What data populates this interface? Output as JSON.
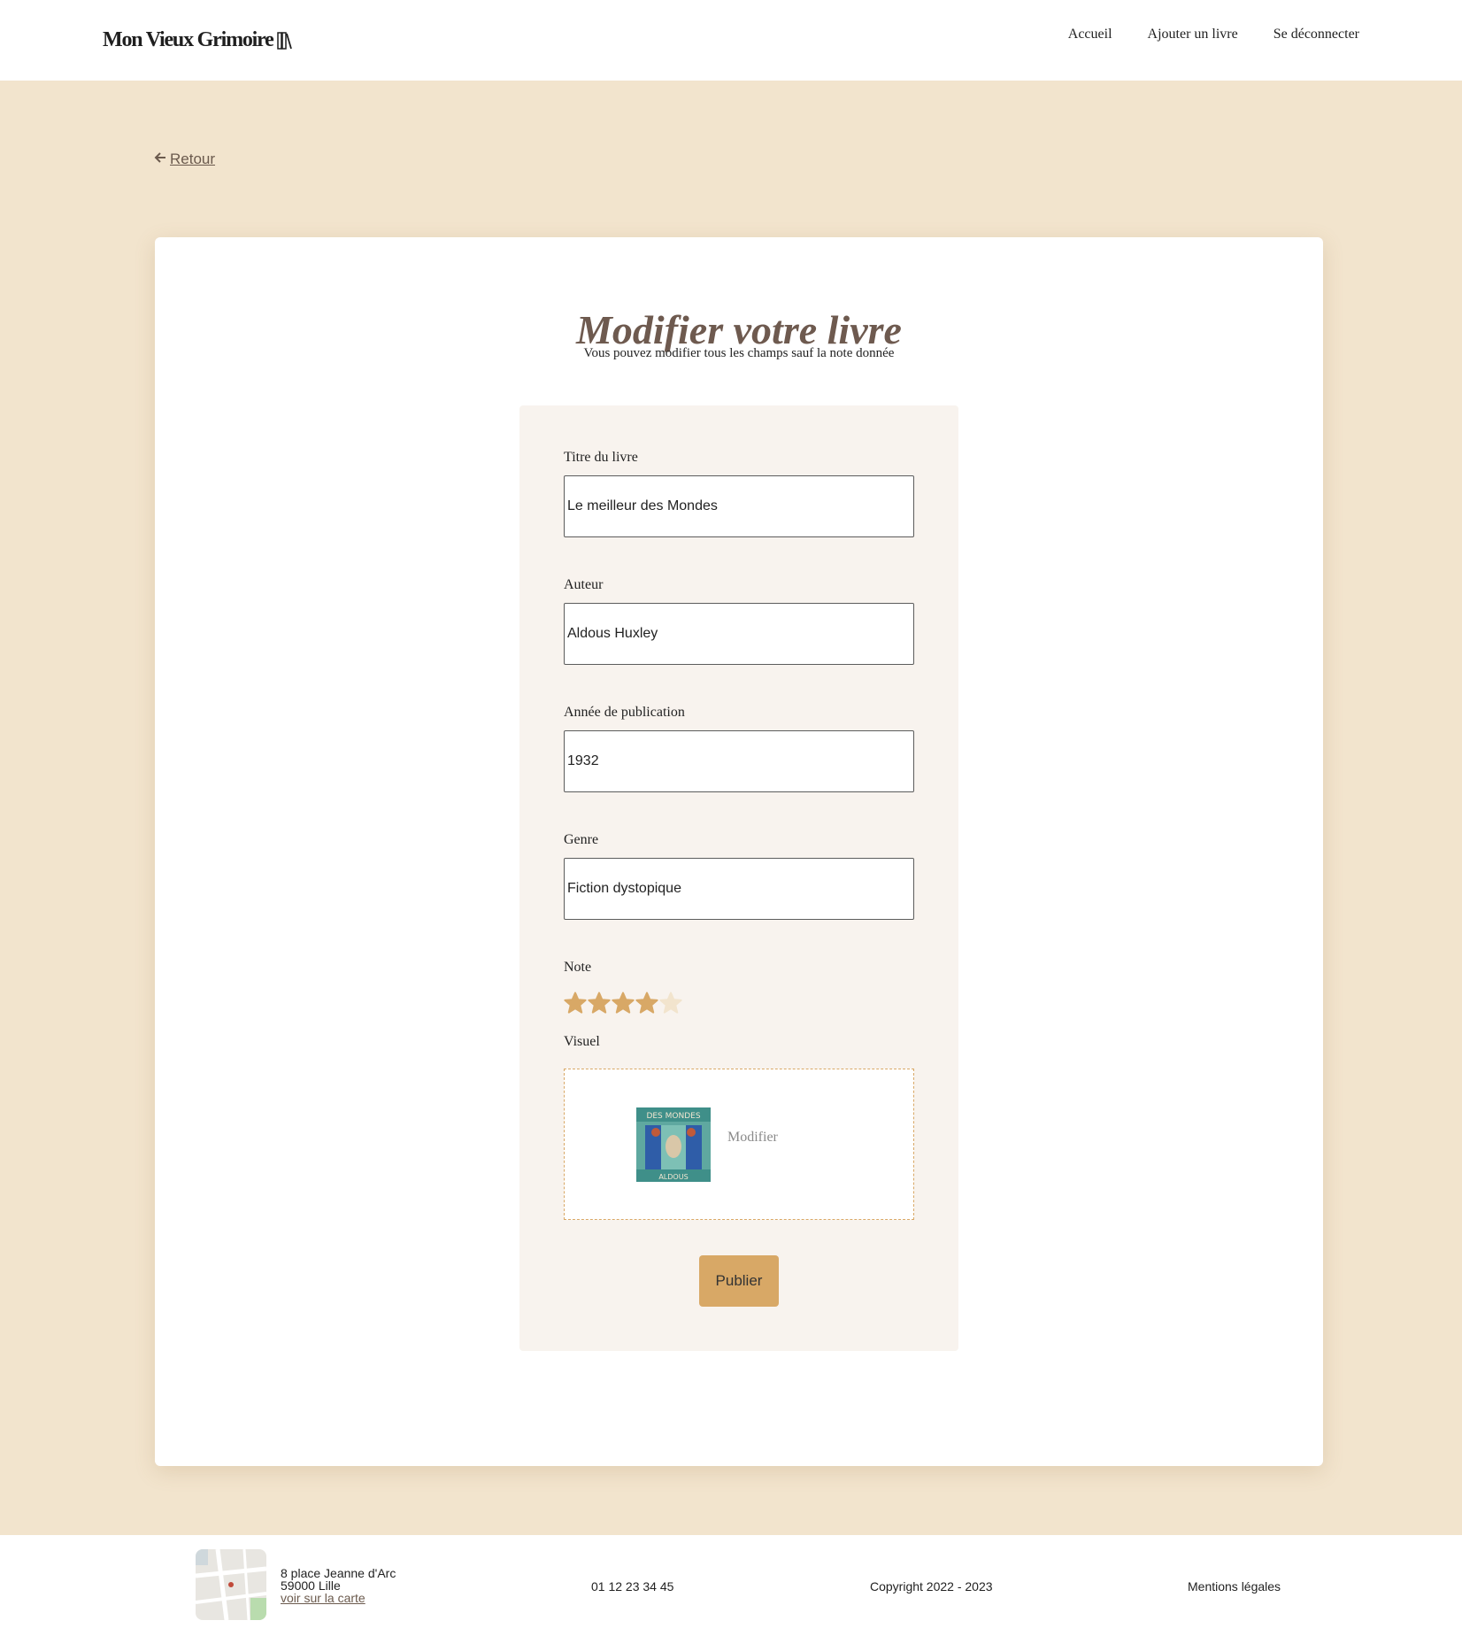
{
  "header": {
    "logo_text": "Mon Vieux Grimoire",
    "nav": [
      {
        "label": "Accueil"
      },
      {
        "label": "Ajouter un livre"
      },
      {
        "label": "Se déconnecter"
      }
    ]
  },
  "back_link": {
    "label": "Retour",
    "icon": "arrow-left-icon"
  },
  "main": {
    "title": "Modifier votre livre",
    "subtitle": "Vous pouvez modifier tous les champs sauf la note donnée"
  },
  "form": {
    "title_label": "Titre du livre",
    "title_value": "Le meilleur des Mondes",
    "author_label": "Auteur",
    "author_value": "Aldous Huxley",
    "year_label": "Année de publication",
    "year_value": "1932",
    "genre_label": "Genre",
    "genre_value": "Fiction dystopique",
    "rating_label": "Note",
    "rating": {
      "value": 4,
      "max": 5
    },
    "visual_label": "Visuel",
    "cover_text_top": "DES MONDES",
    "cover_text_bottom": "ALDOUS",
    "modify_label": "Modifier",
    "publish_label": "Publier"
  },
  "footer": {
    "address_line1": "8 place Jeanne d'Arc",
    "address_line2": "59000 Lille",
    "map_link": "voir sur la carte",
    "phone": "01 12 23 34 45",
    "copyright": "Copyright 2022 - 2023",
    "legal": "Mentions légales"
  },
  "colors": {
    "page_bg": "#f2e4cd",
    "accent": "#d8a866",
    "star_filled": "#d8a866",
    "star_empty": "#f2e4cd",
    "title_color": "#6e5a4f"
  }
}
